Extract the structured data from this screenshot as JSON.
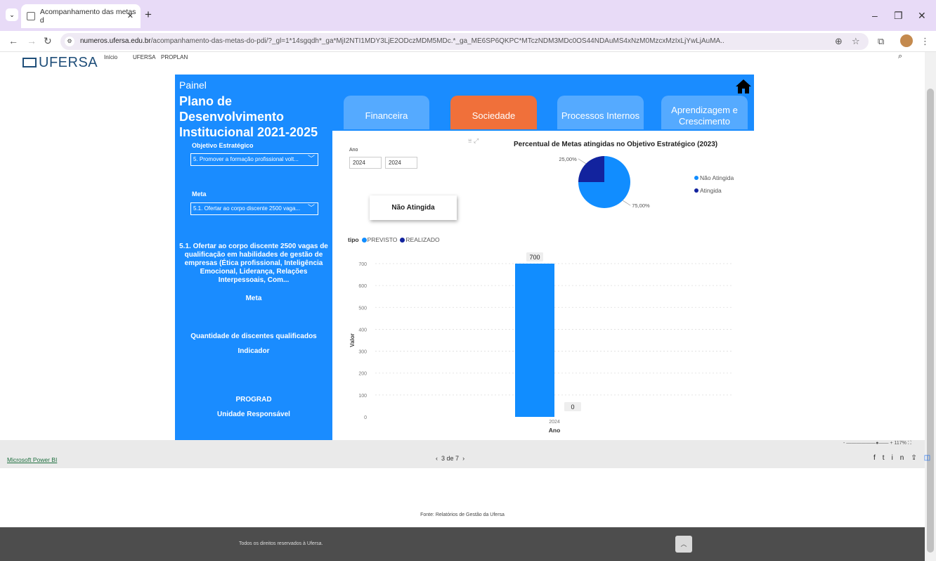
{
  "browser": {
    "tab_title": "Acompanhamento das metas d",
    "url_domain": "numeros.ufersa.edu.br",
    "url_path": "/acompanhamento-das-metas-do-pdi/?_gl=1*14sgqdh*_ga*MjI2NTI1MDY3LjE2ODczMDM5MDc.*_ga_ME6SP6QKPC*MTczNDM3MDc0OS44NDAuMS4xNzM0MzcxMzIxLjYwLjAuMA.."
  },
  "site": {
    "logo": "UFERSA",
    "nav": [
      "Início",
      "UFERSA",
      "PROPLAN"
    ]
  },
  "report": {
    "painel_label": "Painel",
    "title": "Plano de Desenvolvimento Institucional 2021-2025",
    "tabs": [
      {
        "label": "Financeira",
        "active": false
      },
      {
        "label": "Sociedade",
        "active": true
      },
      {
        "label": "Processos Internos",
        "active": false
      },
      {
        "label": "Aprendizagem e Crescimento",
        "active": false
      }
    ],
    "objetivo_label": "Objetivo Estratégico",
    "objetivo_value": "5. Promover a formação profissional volt...",
    "meta_label": "Meta",
    "meta_value": "5.1. Ofertar ao corpo discente 2500 vaga...",
    "meta_text": "5.1. Ofertar ao corpo discente 2500 vagas de qualificação em habilidades de gestão de empresas (Ética profissional, Inteligência Emocional, Liderança, Relações Interpessoais, Com...",
    "meta_caption": "Meta",
    "indicador_text": "Quantidade de discentes qualificados",
    "indicador_caption": "Indicador",
    "unidade_text": "PROGRAD",
    "unidade_caption": "Unidade Responsável",
    "ano_label": "Ano",
    "ano_from": "2024",
    "ano_to": "2024",
    "status": "Não Atingida"
  },
  "colors": {
    "primary": "#1a8cff",
    "active_tab": "#f0703a",
    "previsto": "#118dff",
    "realizado": "#12239e"
  },
  "chart_data": [
    {
      "type": "pie",
      "title": "Percentual de Metas atingidas no Objetivo Estratégico (2023)",
      "slices": [
        {
          "name": "Não Atingida",
          "value": 75,
          "label": "75,00%",
          "color": "#118dff"
        },
        {
          "name": "Atingida",
          "value": 25,
          "label": "25,00%",
          "color": "#12239e"
        }
      ],
      "legend_position": "right"
    },
    {
      "type": "bar",
      "legend_title": "tipo",
      "categories": [
        "2024"
      ],
      "series": [
        {
          "name": "PREVISTO",
          "values": [
            700
          ],
          "color": "#118dff"
        },
        {
          "name": "REALIZADO",
          "values": [
            0
          ],
          "color": "#12239e"
        }
      ],
      "xlabel": "Ano",
      "ylabel": "Valor",
      "ylim": [
        0,
        700
      ],
      "yticks": [
        0,
        100,
        200,
        300,
        400,
        500,
        600,
        700
      ],
      "grid": true
    }
  ],
  "footer": {
    "powerbi_link": "Microsoft Power BI",
    "pager": "3 de 7",
    "zoom": "117%",
    "fonte": "Fonte: Relatórios de Gestão da Ufersa",
    "rights": "Todos os direitos reservados à Ufersa."
  }
}
